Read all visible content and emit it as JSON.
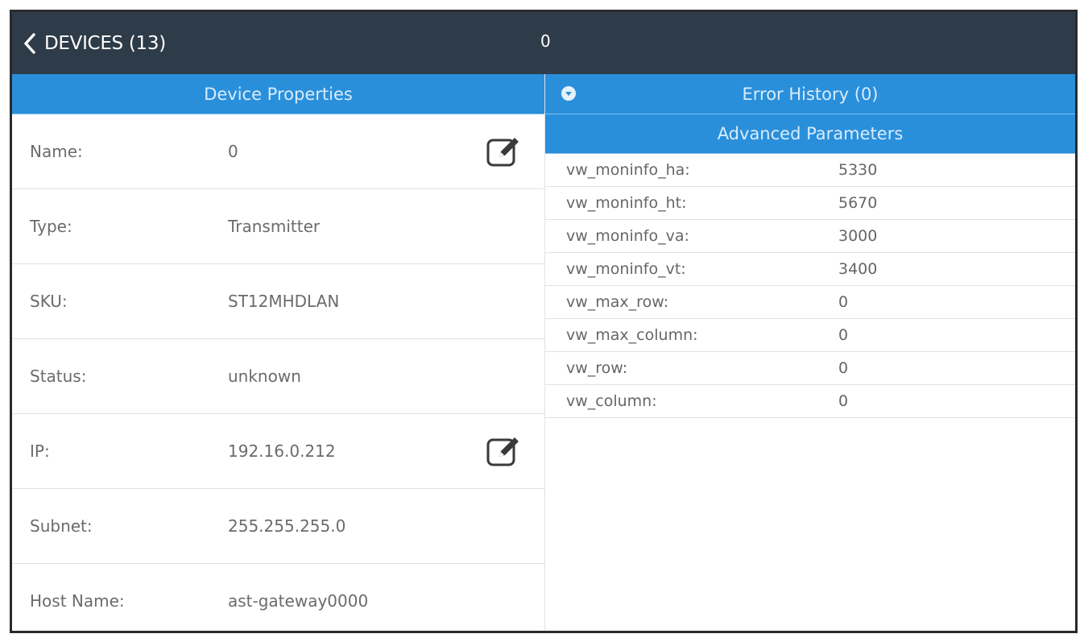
{
  "topbar": {
    "back_label": "DEVICES (13)",
    "center_value": "0"
  },
  "device_properties": {
    "header": "Device Properties",
    "rows": [
      {
        "label": "Name:",
        "value": "0",
        "editable": true
      },
      {
        "label": "Type:",
        "value": "Transmitter",
        "editable": false
      },
      {
        "label": "SKU:",
        "value": "ST12MHDLAN",
        "editable": false
      },
      {
        "label": "Status:",
        "value": "unknown",
        "editable": false
      },
      {
        "label": "IP:",
        "value": "192.16.0.212",
        "editable": true
      },
      {
        "label": "Subnet:",
        "value": "255.255.255.0",
        "editable": false
      },
      {
        "label": "Host Name:",
        "value": "ast-gateway0000",
        "editable": false
      }
    ]
  },
  "error_history": {
    "header": "Error History (0)",
    "icon": "chevron-down-circle-icon"
  },
  "advanced_parameters": {
    "header": "Advanced Parameters",
    "rows": [
      {
        "name": "vw_moninfo_ha:",
        "value": "5330"
      },
      {
        "name": "vw_moninfo_ht:",
        "value": "5670"
      },
      {
        "name": "vw_moninfo_va:",
        "value": "3000"
      },
      {
        "name": "vw_moninfo_vt:",
        "value": "3400"
      },
      {
        "name": "vw_max_row:",
        "value": "0"
      },
      {
        "name": "vw_max_column:",
        "value": "0"
      },
      {
        "name": "vw_row:",
        "value": "0"
      },
      {
        "name": "vw_column:",
        "value": "0"
      }
    ]
  },
  "colors": {
    "topbar": "#2e3b48",
    "header_blue": "#2a8fdb",
    "text_gray": "#6b6b6b"
  }
}
